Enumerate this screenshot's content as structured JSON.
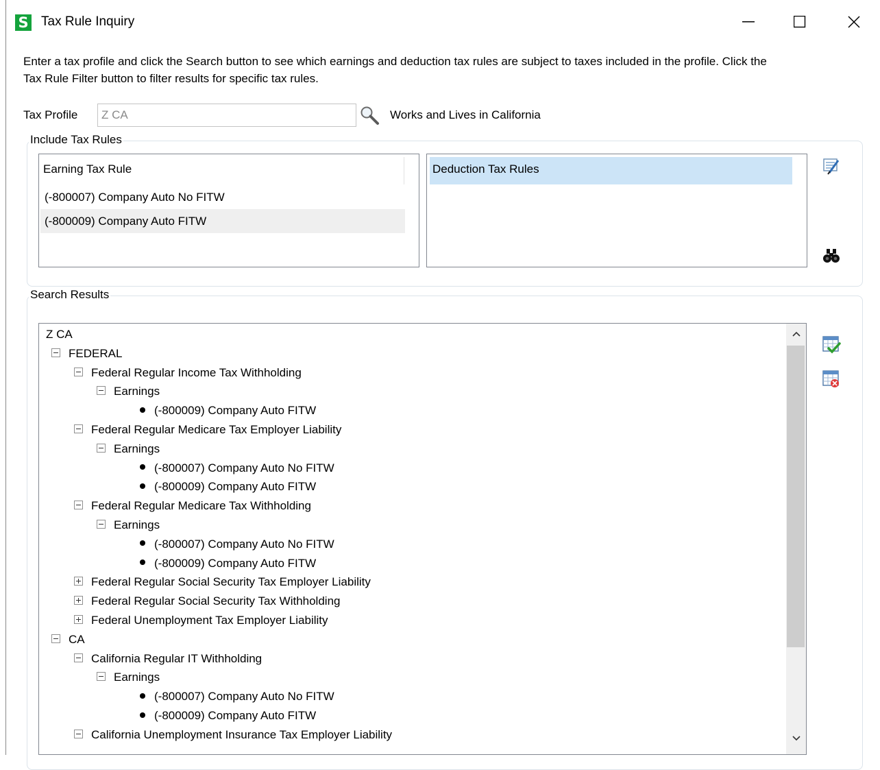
{
  "window": {
    "app_icon_letter": "S",
    "title": "Tax Rule Inquiry"
  },
  "instructions": "Enter a tax profile and click the Search button to see which earnings and deduction tax rules are subject to taxes included in the profile. Click the Tax Rule Filter button to filter results for specific tax rules.",
  "tax_profile": {
    "label": "Tax Profile",
    "value": "Z CA",
    "description": "Works and Lives in California"
  },
  "include_tax_rules": {
    "title": "Include Tax Rules",
    "earning_header": "Earning Tax Rule",
    "earnings": [
      "(-800007) Company Auto No FITW",
      "(-800009) Company Auto FITW"
    ],
    "deduction_header": "Deduction Tax Rules"
  },
  "search_results": {
    "title": "Search Results",
    "tree": [
      {
        "level": 0,
        "toggle": "none",
        "text": "Z CA"
      },
      {
        "level": 1,
        "toggle": "minus",
        "text": "FEDERAL"
      },
      {
        "level": 2,
        "toggle": "minus",
        "text": "Federal Regular Income Tax Withholding"
      },
      {
        "level": 3,
        "toggle": "minus",
        "text": "Earnings"
      },
      {
        "level": 4,
        "toggle": "bullet",
        "text": "(-800009) Company Auto FITW"
      },
      {
        "level": 2,
        "toggle": "minus",
        "text": "Federal Regular Medicare Tax Employer Liability"
      },
      {
        "level": 3,
        "toggle": "minus",
        "text": "Earnings"
      },
      {
        "level": 4,
        "toggle": "bullet",
        "text": "(-800007) Company Auto No FITW"
      },
      {
        "level": 4,
        "toggle": "bullet",
        "text": "(-800009) Company Auto FITW"
      },
      {
        "level": 2,
        "toggle": "minus",
        "text": "Federal Regular Medicare Tax Withholding"
      },
      {
        "level": 3,
        "toggle": "minus",
        "text": "Earnings"
      },
      {
        "level": 4,
        "toggle": "bullet",
        "text": "(-800007) Company Auto No FITW"
      },
      {
        "level": 4,
        "toggle": "bullet",
        "text": "(-800009) Company Auto FITW"
      },
      {
        "level": 2,
        "toggle": "plus",
        "text": "Federal Regular Social Security Tax Employer Liability"
      },
      {
        "level": 2,
        "toggle": "plus",
        "text": "Federal Regular Social Security Tax Withholding"
      },
      {
        "level": 2,
        "toggle": "plus",
        "text": "Federal Unemployment Tax Employer Liability"
      },
      {
        "level": 1,
        "toggle": "minus",
        "text": "CA"
      },
      {
        "level": 2,
        "toggle": "minus",
        "text": "California Regular IT Withholding"
      },
      {
        "level": 3,
        "toggle": "minus",
        "text": "Earnings"
      },
      {
        "level": 4,
        "toggle": "bullet",
        "text": "(-800007) Company Auto No FITW"
      },
      {
        "level": 4,
        "toggle": "bullet",
        "text": "(-800009) Company Auto FITW"
      },
      {
        "level": 2,
        "toggle": "minus",
        "text": "California Unemployment Insurance Tax Employer Liability"
      }
    ]
  },
  "icons": {
    "app": "sage-logo-icon",
    "search": "magnifier-icon",
    "filter": "tax-rule-filter-icon",
    "find": "binoculars-icon",
    "expand_all": "grid-check-icon",
    "collapse_all": "grid-clear-icon"
  },
  "colors": {
    "app_icon_bg": "#14a33c",
    "selected_row_bg": "#cce4f7",
    "hover_row_bg": "#efefef"
  }
}
